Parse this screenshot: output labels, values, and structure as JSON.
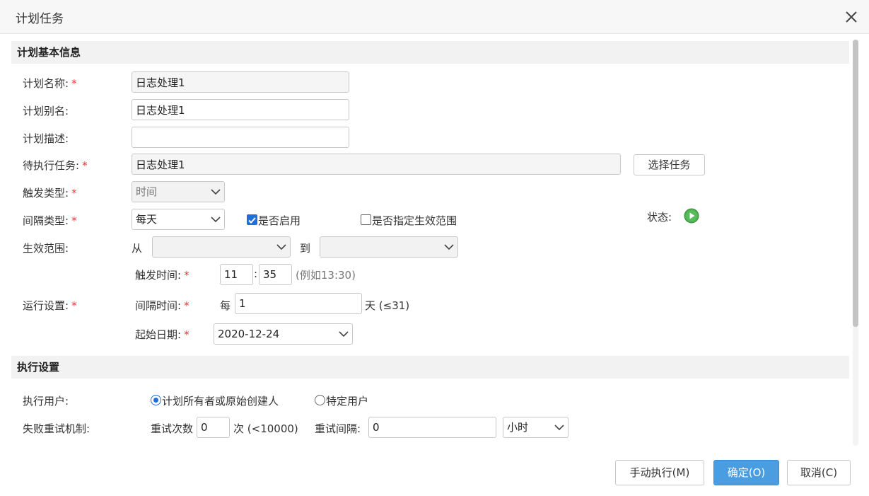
{
  "dialog": {
    "title": "计划任务",
    "close_icon": "close-icon"
  },
  "basic": {
    "section_title": "计划基本信息",
    "name_label": "计划名称:",
    "name_value": "日志处理1",
    "alias_label": "计划别名:",
    "alias_value": "日志处理1",
    "desc_label": "计划描述:",
    "desc_value": "",
    "task_label": "待执行任务:",
    "task_value": "日志处理1",
    "select_task_button": "选择任务",
    "trigger_type_label": "触发类型:",
    "trigger_type_value": "时间",
    "interval_type_label": "间隔类型:",
    "interval_type_value": "每天",
    "enabled_label": "是否启用",
    "enabled_checked": true,
    "range_flag_label": "是否指定生效范围",
    "range_flag_checked": false,
    "status_label": "状态:",
    "status_icon": "play-icon",
    "status_color": "#4caf50",
    "range_label": "生效范围:",
    "range_from": "从",
    "range_to": "到",
    "range_from_value": "",
    "range_to_value": "",
    "run_label": "运行设置:",
    "trigger_time_label": "触发时间:",
    "trigger_hour": "11",
    "time_sep": ":",
    "trigger_minute": "35",
    "trigger_time_hint": "(例如13:30)",
    "interval_time_label": "间隔时间:",
    "interval_prefix": "每",
    "interval_value": "1",
    "interval_unit_hint": "天 (≤31)",
    "start_date_label": "起始日期:",
    "start_date_value": "2020-12-24",
    "required_mark": "*"
  },
  "exec": {
    "section_title": "执行设置",
    "user_label": "执行用户:",
    "option_owner": "计划所有者或原始创建人",
    "option_specific": "特定用户",
    "selected": "owner",
    "retry_label": "失败重试机制:",
    "retry_count_label": "重试次数",
    "retry_count_value": "0",
    "retry_count_hint": "次 (<10000)",
    "retry_interval_label": "重试间隔:",
    "retry_interval_value": "0",
    "retry_unit_value": "小时"
  },
  "footer": {
    "manual_run": "手动执行(M)",
    "ok": "确定(O)",
    "cancel": "取消(C)"
  },
  "colors": {
    "primary": "#4a9de0",
    "required": "#e4393c",
    "section_bg": "#f2f2f2"
  }
}
